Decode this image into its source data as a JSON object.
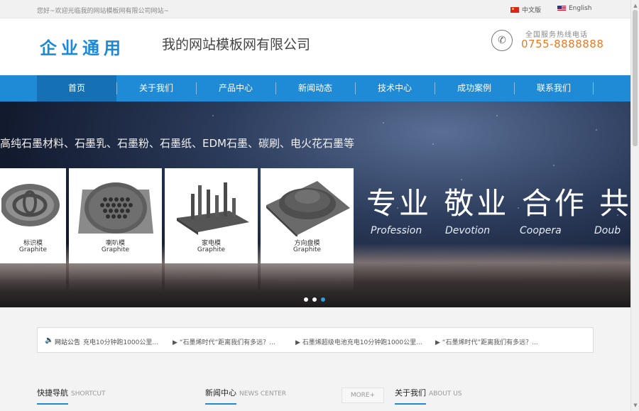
{
  "topbar": {
    "welcome": "您好~欢迎光临我的网站模板网有限公司网站~",
    "lang_cn": "中文版",
    "lang_en": "English"
  },
  "header": {
    "logo": "企业通用",
    "company_name": "我的网站模板网有限公司",
    "hotline_label": "全国服务热线电话",
    "hotline_number": "0755-8888888"
  },
  "nav": {
    "items": [
      "首页",
      "关于我们",
      "产品中心",
      "新闻动态",
      "技术中心",
      "成功案例",
      "联系我们"
    ],
    "active": "首页"
  },
  "banner": {
    "tagline": "高纯石墨材料、石墨乳、石墨粉、石墨纸、EDM石墨、碳刷、电火花石墨等",
    "products": [
      {
        "cn": "标识模",
        "en": "Graphite"
      },
      {
        "cn": "喇叭模",
        "en": "Graphite"
      },
      {
        "cn": "家电模",
        "en": "Graphite"
      },
      {
        "cn": "方向盘模",
        "en": "Graphite"
      }
    ],
    "slogan": "专业 敬业 合作 共",
    "slogan_en": [
      "Profession",
      "Devotion",
      "Coopera",
      "Doub"
    ],
    "active_dot": 3,
    "dot_count": 3
  },
  "notice": {
    "label": "网站公告",
    "items": [
      "充电10分钟跑1000公里...",
      "▶ “石墨烯时代”距离我们有多远？...",
      "▶ 石墨烯超级电池充电10分钟跑1000公里...",
      "▶ “石墨烯时代”距离我们有多远？..."
    ]
  },
  "sections": {
    "shortcut": {
      "title": "快捷导航",
      "en": "SHORTCUT"
    },
    "news": {
      "title": "新闻中心",
      "en": "NEWS CENTER"
    },
    "more": "MORE+",
    "about": {
      "title": "关于我们",
      "en": "ABOUT US"
    }
  },
  "colors": {
    "brand_blue": "#1f8bd6",
    "nav_active": "#1570b4",
    "hotline_orange": "#e97921"
  }
}
